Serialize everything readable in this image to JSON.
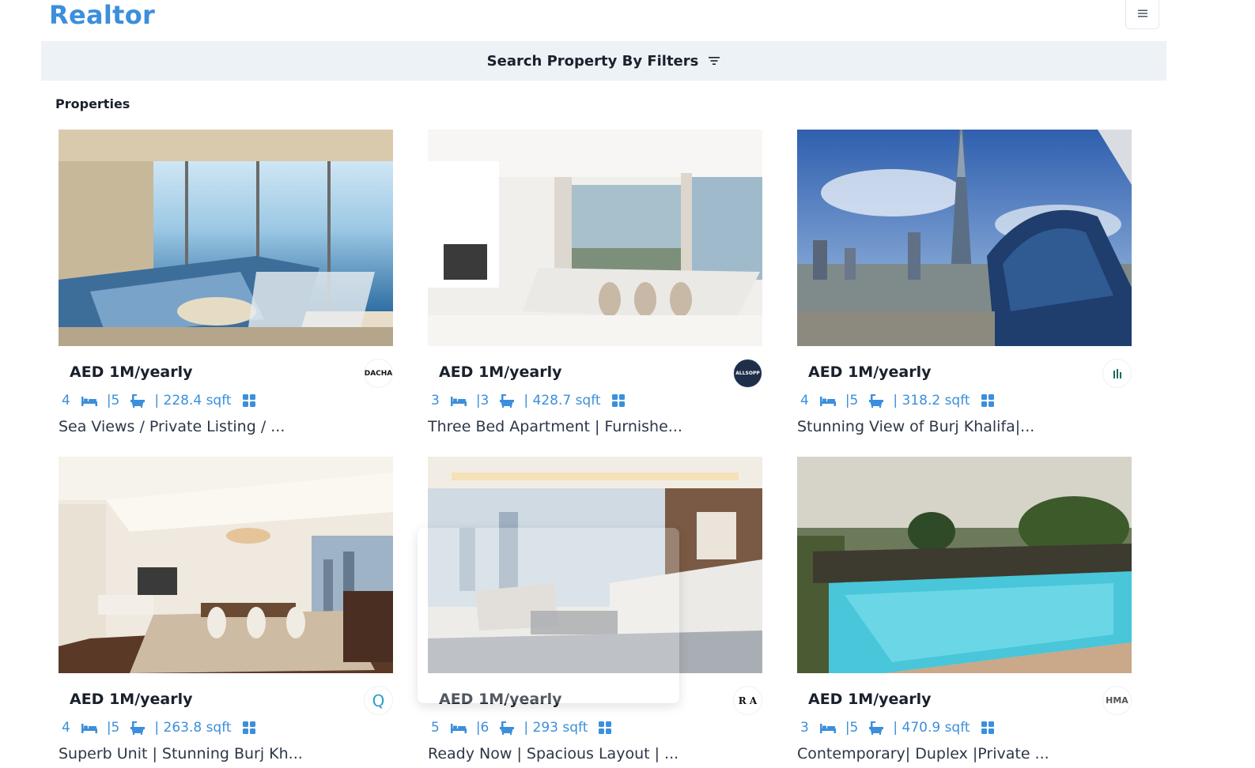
{
  "header": {
    "brand": "Realtor",
    "menu_icon": "hamburger-icon"
  },
  "filter_bar": {
    "label": "Search Property By Filters",
    "icon": "filter-icon"
  },
  "section": {
    "title": "Properties"
  },
  "colors": {
    "accent": "#3b8fdc",
    "filter_bg": "#edf2f7",
    "text": "#1a202c"
  },
  "properties": [
    {
      "price": "AED 1M/yearly",
      "beds": "4",
      "baths": "|5",
      "area": "| 228.4 sqft",
      "title": "Sea Views / Private Listing / ...",
      "agency_logo": "DACHA"
    },
    {
      "price": "AED 1M/yearly",
      "beds": "3",
      "baths": "|3",
      "area": "| 428.7 sqft",
      "title": "Three Bed Apartment | Furnishe...",
      "agency_logo": "ALLSOPP"
    },
    {
      "price": "AED 1M/yearly",
      "beds": "4",
      "baths": "|5",
      "area": "| 318.2 sqft",
      "title": "Stunning View of Burj Khalifa|...",
      "agency_logo": ""
    },
    {
      "price": "AED 1M/yearly",
      "beds": "4",
      "baths": "|5",
      "area": "| 263.8 sqft",
      "title": "Superb Unit | Stunning Burj Kh...",
      "agency_logo": "Q"
    },
    {
      "price": "AED 1M/yearly",
      "beds": "5",
      "baths": "|6",
      "area": "| 293 sqft",
      "title": "Ready Now | Spacious Layout | ...",
      "agency_logo": "R A"
    },
    {
      "price": "AED 1M/yearly",
      "beds": "3",
      "baths": "|5",
      "area": "| 470.9 sqft",
      "title": "Contemporary| Duplex |Private ...",
      "agency_logo": "HMA"
    }
  ],
  "icons": {
    "bed": "bed-icon",
    "bath": "bath-icon",
    "area": "grid-icon"
  }
}
